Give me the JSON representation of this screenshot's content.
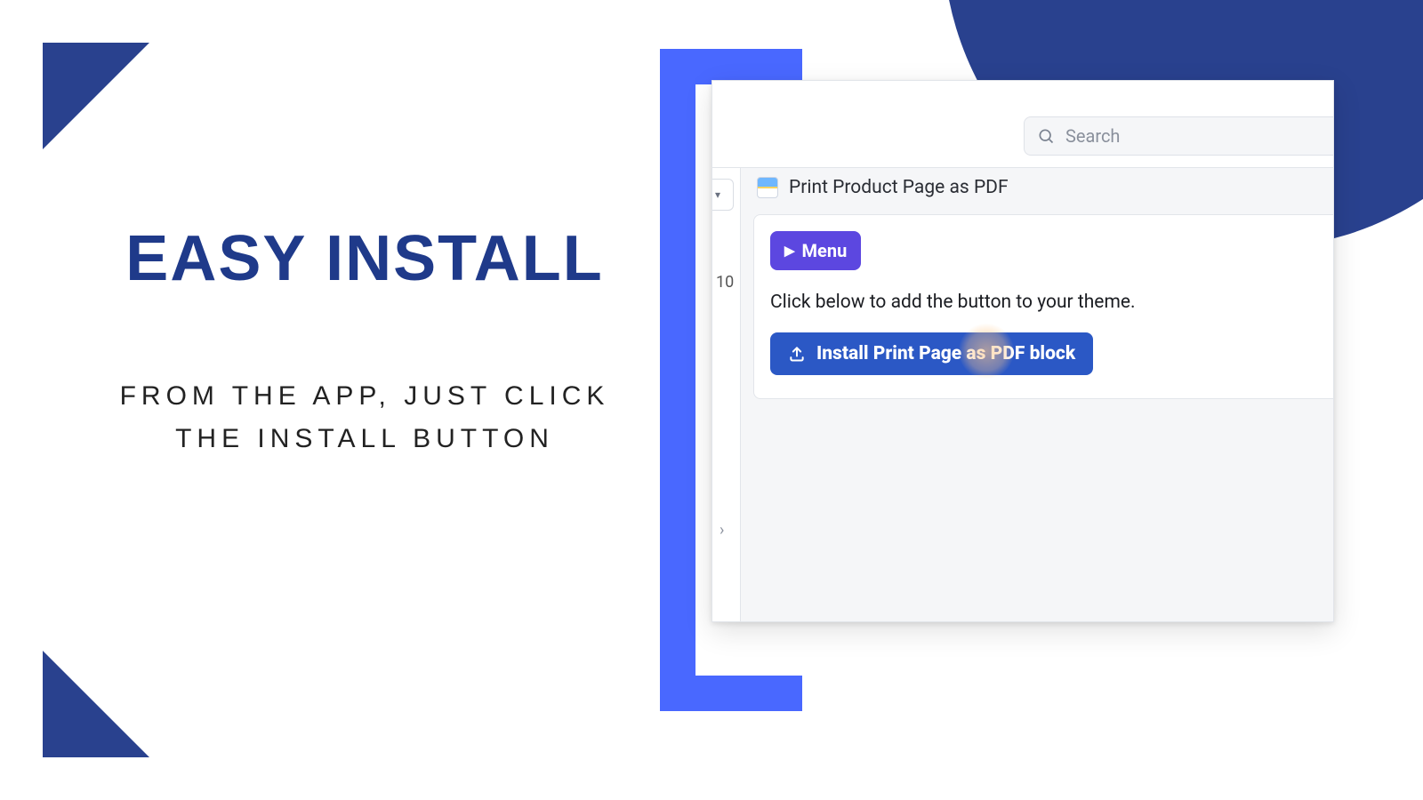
{
  "decor": {
    "accent": "#29418e",
    "bracket_color": "#4968ff"
  },
  "headline": "EASY INSTALL",
  "subline": "FROM THE APP, JUST CLICK THE INSTALL BUTTON",
  "app": {
    "search_placeholder": "Search",
    "title": "Print Product Page as PDF",
    "badge_number": "10",
    "menu_label": "Menu",
    "instruction": "Click below to add the button to your theme.",
    "install_label": "Install Print Page as PDF block"
  }
}
